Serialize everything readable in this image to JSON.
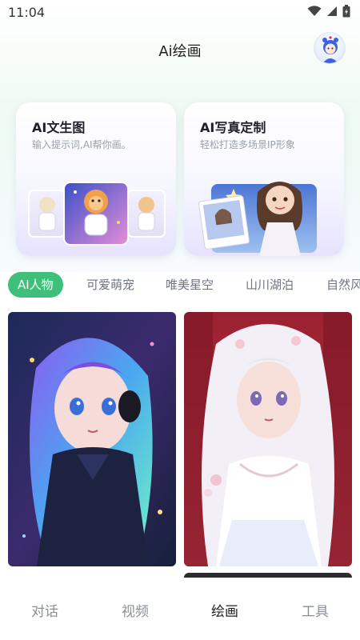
{
  "status_bar": {
    "time": "11:04"
  },
  "header": {
    "title": "Ai绘画"
  },
  "cards": [
    {
      "title": "AI文生图",
      "subtitle": "输入提示词,AI帮你画。"
    },
    {
      "title": "AI写真定制",
      "subtitle": "轻松打造多场景IP形象"
    }
  ],
  "categories": [
    {
      "label": "AI人物",
      "active": true
    },
    {
      "label": "可爱萌宠",
      "active": false
    },
    {
      "label": "唯美星空",
      "active": false
    },
    {
      "label": "山川湖泊",
      "active": false
    },
    {
      "label": "自然风",
      "active": false
    }
  ],
  "bottom_nav": [
    {
      "label": "对话",
      "active": false
    },
    {
      "label": "视频",
      "active": false
    },
    {
      "label": "绘画",
      "active": true
    },
    {
      "label": "工具",
      "active": false
    }
  ],
  "colors": {
    "accent_green": "#3ec07a",
    "card_gradient_end": "#e6e2ff",
    "inactive_text": "#8a8f98"
  },
  "icons": {
    "status": [
      "wifi-icon",
      "signal-icon",
      "battery-icon"
    ],
    "header_right": "avatar"
  }
}
